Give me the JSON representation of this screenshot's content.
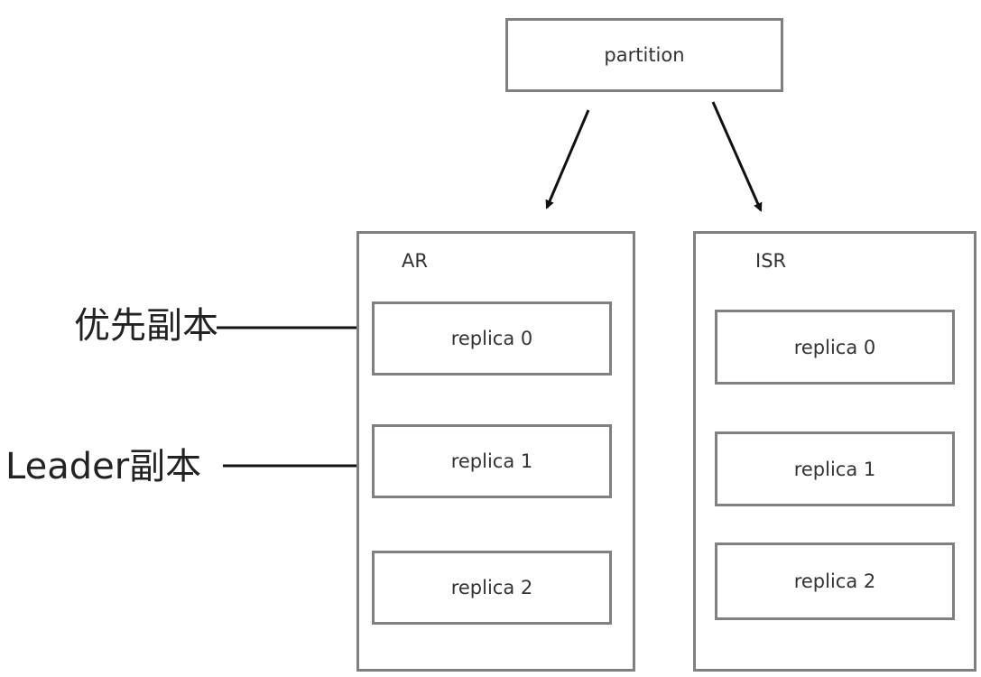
{
  "partition": {
    "label": "partition"
  },
  "ar": {
    "title": "AR",
    "replicas": [
      "replica 0",
      "replica 1",
      "replica 2"
    ]
  },
  "isr": {
    "title": "ISR",
    "replicas": [
      "replica 0",
      "replica 1",
      "replica 2"
    ]
  },
  "annotations": {
    "preferred_replica": "优先副本",
    "leader_replica": "Leader副本"
  },
  "colors": {
    "box_border": "#808080",
    "arrow": "#111111",
    "text": "#333333"
  }
}
